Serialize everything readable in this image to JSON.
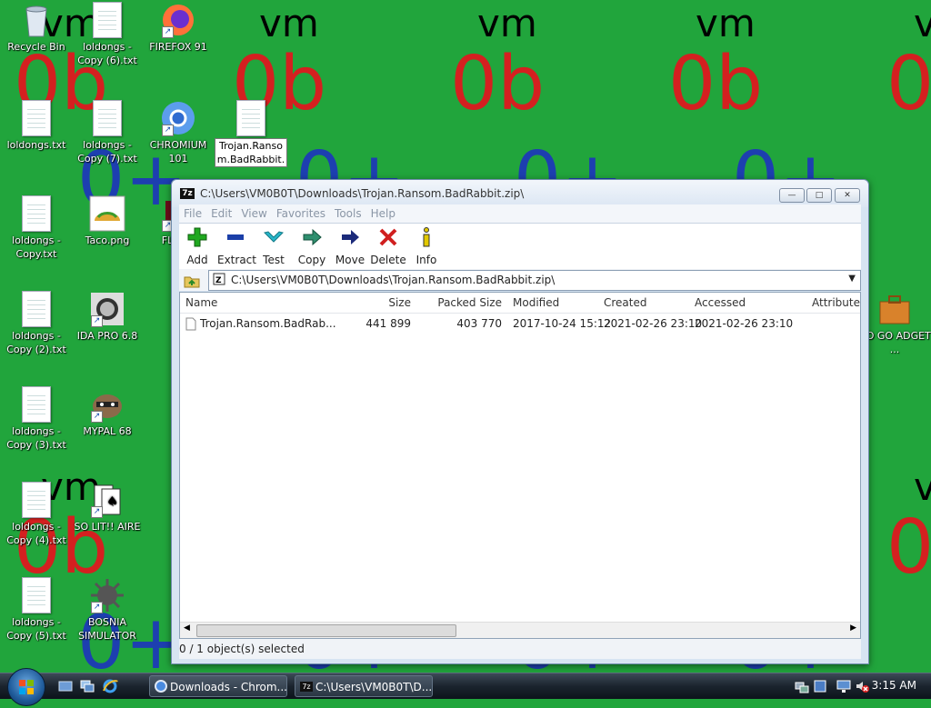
{
  "desktop": {
    "icons": [
      {
        "label": "Recycle Bin",
        "icon": "recycle-bin-icon"
      },
      {
        "label": "loldongs - Copy (6).txt",
        "icon": "text-file-icon"
      },
      {
        "label": "FIREFOX 91",
        "icon": "firefox-icon"
      },
      {
        "label": "loldongs.txt",
        "icon": "text-file-icon"
      },
      {
        "label": "loldongs - Copy (7).txt",
        "icon": "text-file-icon"
      },
      {
        "label": "CHROMIUM 101",
        "icon": "chromium-icon"
      },
      {
        "label": "Trojan.Ranso m.BadRabbit.",
        "icon": "blank-file-icon"
      },
      {
        "label": "loldongs - Copy.txt",
        "icon": "text-file-icon"
      },
      {
        "label": "Taco.png",
        "icon": "taco-image-icon"
      },
      {
        "label": "FL PLA",
        "icon": "app-shortcut-icon"
      },
      {
        "label": "loldongs - Copy (2).txt",
        "icon": "text-file-icon"
      },
      {
        "label": "IDA PRO 6.8",
        "icon": "ida-pro-icon"
      },
      {
        "label": "GO GO ADGET ...",
        "icon": "briefcase-icon"
      },
      {
        "label": "loldongs - Copy (3).txt",
        "icon": "text-file-icon"
      },
      {
        "label": "MYPAL 68",
        "icon": "raccoon-icon"
      },
      {
        "label": "loldongs - Copy (4).txt",
        "icon": "text-file-icon"
      },
      {
        "label": "SO LIT!! AIRE",
        "icon": "cards-icon"
      },
      {
        "label": "loldongs - Copy (5).txt",
        "icon": "text-file-icon"
      },
      {
        "label": "BOSNIA SIMULATOR",
        "icon": "mine-icon"
      }
    ],
    "wallpaper": {
      "tiles": [
        "vm",
        "0b",
        "0+"
      ]
    }
  },
  "window": {
    "title": "C:\\Users\\VM0B0T\\Downloads\\Trojan.Ransom.BadRabbit.zip\\",
    "menu": [
      "File",
      "Edit",
      "View",
      "Favorites",
      "Tools",
      "Help"
    ],
    "toolbar": [
      "Add",
      "Extract",
      "Test",
      "Copy",
      "Move",
      "Delete",
      "Info"
    ],
    "address": "C:\\Users\\VM0B0T\\Downloads\\Trojan.Ransom.BadRabbit.zip\\",
    "columns": [
      "Name",
      "Size",
      "Packed Size",
      "Modified",
      "Created",
      "Accessed",
      "Attribute"
    ],
    "rows": [
      {
        "name": "Trojan.Ransom.BadRab...",
        "size": "441 899",
        "packed": "403 770",
        "modified": "2017-10-24 15:12",
        "created": "2021-02-26 23:10",
        "accessed": "2021-02-26 23:10"
      }
    ],
    "status": "0 / 1 object(s) selected"
  },
  "taskbar": {
    "tasks": [
      {
        "label": "Downloads - Chrom...",
        "icon": "chromium-icon"
      },
      {
        "label": "C:\\Users\\VM0B0T\\D...",
        "icon": "7zip-icon"
      }
    ],
    "clock": "3:15 AM"
  },
  "colors": {
    "wallpaper": "#21a53c",
    "window_frame": "#d7e4f2",
    "add": "#1fa81f",
    "extract": "#1b3fa8",
    "test": "#28b6c9",
    "copy": "#2f8f6f",
    "move": "#1b2a7a",
    "delete": "#d01f1f",
    "info": "#e2c800"
  }
}
